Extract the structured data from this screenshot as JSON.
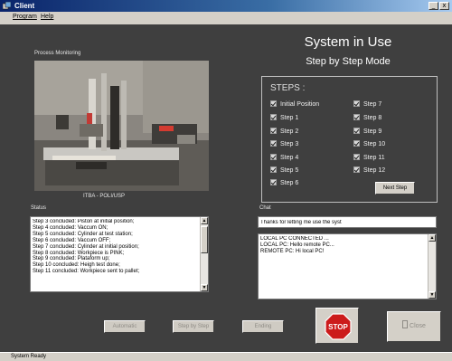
{
  "window": {
    "title": "Client",
    "minimize": "_",
    "close": "x"
  },
  "menu": [
    "Program",
    "Help"
  ],
  "monitor": {
    "label": "Process Monitoring",
    "camera_caption": "ITBA - POLI/USP"
  },
  "header": {
    "title": "System in Use",
    "subtitle": "Step by Step Mode"
  },
  "steps": {
    "title": "STEPS :",
    "left": [
      "Initial Position",
      "Step 1",
      "Step 2",
      "Step 3",
      "Step 4",
      "Step 5",
      "Step 6"
    ],
    "right": [
      "Step 7",
      "Step 8",
      "Step 9",
      "Step 10",
      "Step 11",
      "Step 12"
    ],
    "next_label": "Next Step"
  },
  "status": {
    "label": "Status",
    "lines": [
      "Step 3 concluded: Piston at initial position;",
      "Step 4 concluded: Vaccum ON;",
      "Step 5 concluded: Cylinder at test station;",
      "Step 6 concluded: Vaccum OFF;",
      "Step 7 concluded: Cylinder at initial position;",
      "Step 8 concluded: Workpiece is PINK;",
      "Step 9 concluded: Plataform up;",
      "Step 10 concluded: Heigh test done;",
      "Step 11 concluded: Workpiece sent to pallet;"
    ]
  },
  "chat": {
    "label": "Chat",
    "input_value": "Thanks for letting me use the syst",
    "lines": [
      "LOCAL PC CONNECTED ...",
      "LOCAL PC: Hello remote PC...",
      "REMOTE PC: Hi local PC!"
    ]
  },
  "buttons": {
    "automatic": "Automatic",
    "step_by_step": "Step by Step",
    "ending": "Ending",
    "stop": "STOP",
    "close": "Close"
  },
  "statusbar": "System Ready",
  "colors": {
    "background": "#3f3f3f",
    "title_bar": "#0a246a",
    "stop_red": "#cc1b1b",
    "window_gray": "#d4d0c8"
  }
}
